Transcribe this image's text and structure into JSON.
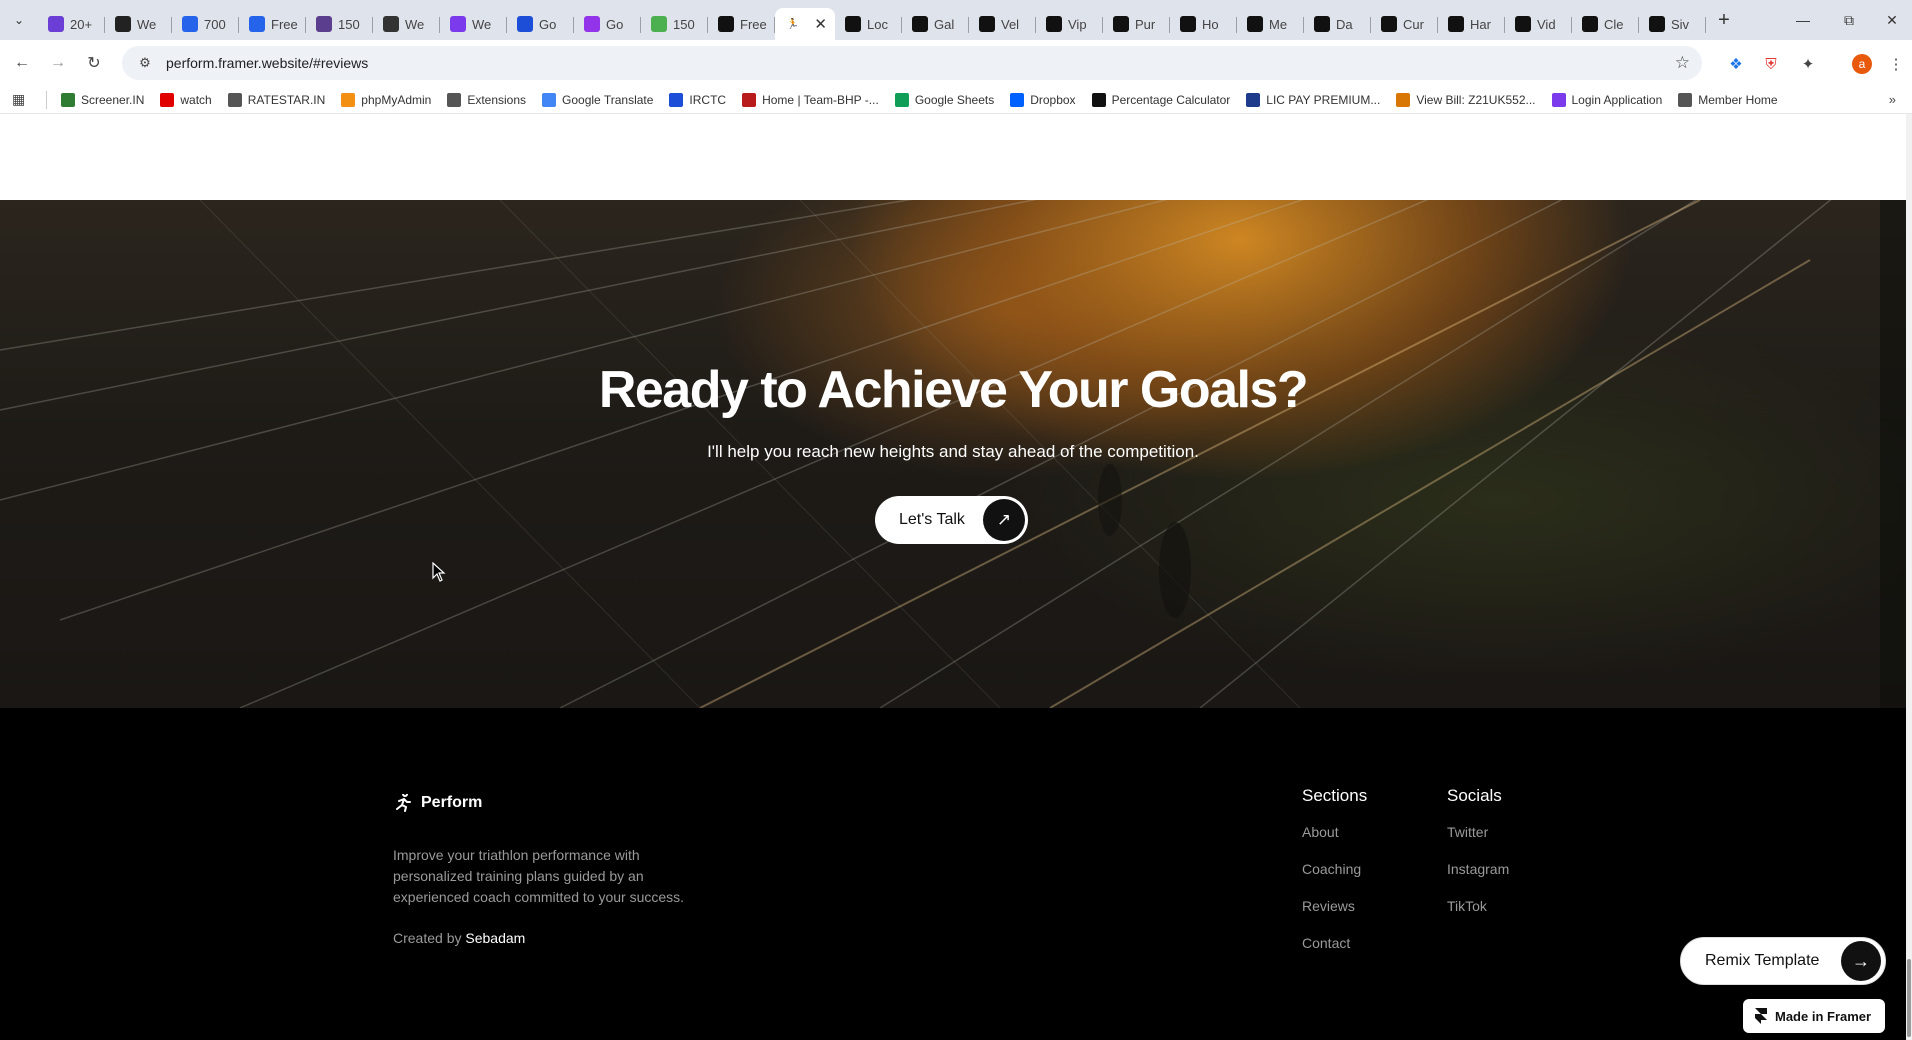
{
  "browser": {
    "tabs": [
      {
        "label": "20+",
        "icon": "astro-icon",
        "color": "#6b3fd6"
      },
      {
        "label": "We",
        "icon": "wix-icon",
        "color": "#222222"
      },
      {
        "label": "700",
        "icon": "framer-blue-icon",
        "color": "#2563eb"
      },
      {
        "label": "Free",
        "icon": "framer-blue-icon",
        "color": "#2563eb"
      },
      {
        "label": "150",
        "icon": "canva-icon",
        "color": "#5b3e8e"
      },
      {
        "label": "We",
        "icon": "webflow-icon",
        "color": "#333333"
      },
      {
        "label": "We",
        "icon": "h-icon",
        "color": "#7c3aed"
      },
      {
        "label": "Go",
        "icon": "calendar-icon",
        "color": "#1d4ed8"
      },
      {
        "label": "Go",
        "icon": "purple-circle-icon",
        "color": "#9333ea"
      },
      {
        "label": "150",
        "icon": "leaf-icon",
        "color": "#4caf50"
      },
      {
        "label": "Free",
        "icon": "framer-icon",
        "color": "#111111"
      },
      {
        "label": "",
        "icon": "runner-icon",
        "color": "#111111",
        "active": true
      },
      {
        "label": "Loc",
        "icon": "framer-icon",
        "color": "#111111"
      },
      {
        "label": "Gal",
        "icon": "framer-icon",
        "color": "#111111"
      },
      {
        "label": "Vel",
        "icon": "framer-icon",
        "color": "#111111"
      },
      {
        "label": "Vip",
        "icon": "framer-icon",
        "color": "#111111"
      },
      {
        "label": "Pur",
        "icon": "framer-icon",
        "color": "#111111"
      },
      {
        "label": "Ho",
        "icon": "framer-icon",
        "color": "#111111"
      },
      {
        "label": "Me",
        "icon": "framer-icon",
        "color": "#111111"
      },
      {
        "label": "Da",
        "icon": "framer-icon",
        "color": "#111111"
      },
      {
        "label": "Cur",
        "icon": "framer-icon",
        "color": "#111111"
      },
      {
        "label": "Har",
        "icon": "framer-icon",
        "color": "#111111"
      },
      {
        "label": "Vid",
        "icon": "framer-icon",
        "color": "#111111"
      },
      {
        "label": "Cle",
        "icon": "framer-icon",
        "color": "#111111"
      },
      {
        "label": "Siv",
        "icon": "framer-icon",
        "color": "#111111"
      }
    ],
    "url": "perform.framer.website/#reviews",
    "profile_initial": "a",
    "bookmarks": [
      {
        "label": "Screener.IN",
        "icon": "bar-chart-icon",
        "color": "#2e7d32"
      },
      {
        "label": "watch",
        "icon": "youtube-icon",
        "color": "#e00000"
      },
      {
        "label": "RATESTAR.IN",
        "icon": "star-icon",
        "color": "#555555"
      },
      {
        "label": "phpMyAdmin",
        "icon": "phpmyadmin-icon",
        "color": "#f29111"
      },
      {
        "label": "Extensions",
        "icon": "puzzle-icon",
        "color": "#555555"
      },
      {
        "label": "Google Translate",
        "icon": "translate-icon",
        "color": "#4285f4"
      },
      {
        "label": "IRCTC",
        "icon": "irctc-icon",
        "color": "#1d4ed8"
      },
      {
        "label": "Home | Team-BHP -...",
        "icon": "teambhp-icon",
        "color": "#b91c1c"
      },
      {
        "label": "Google Sheets",
        "icon": "sheets-icon",
        "color": "#0f9d58"
      },
      {
        "label": "Dropbox",
        "icon": "dropbox-icon",
        "color": "#0061fe"
      },
      {
        "label": "Percentage Calculator",
        "icon": "percent-icon",
        "color": "#111111"
      },
      {
        "label": "LIC PAY PREMIUM...",
        "icon": "lic-icon",
        "color": "#1e3a8a"
      },
      {
        "label": "View Bill: Z21UK552...",
        "icon": "bill-icon",
        "color": "#d97706"
      },
      {
        "label": "Login Application",
        "icon": "login-icon",
        "color": "#7c3aed"
      },
      {
        "label": "Member Home",
        "icon": "globe-icon",
        "color": "#555555"
      }
    ]
  },
  "hero": {
    "title": "Ready to Achieve Your Goals?",
    "subtitle": "I'll help you reach new heights and stay ahead of the competition.",
    "cta_label": "Let's Talk"
  },
  "footer": {
    "brand": "Perform",
    "description": "Improve your triathlon performance with personalized training plans guided by an experienced coach committed to your success.",
    "created_prefix": "Created by",
    "created_author": "Sebadam",
    "sections_title": "Sections",
    "sections": [
      "About",
      "Coaching",
      "Reviews",
      "Contact"
    ],
    "socials_title": "Socials",
    "socials": [
      "Twitter",
      "Instagram",
      "TikTok"
    ]
  },
  "overlay": {
    "remix_label": "Remix Template",
    "made_in_label": "Made in Framer"
  }
}
